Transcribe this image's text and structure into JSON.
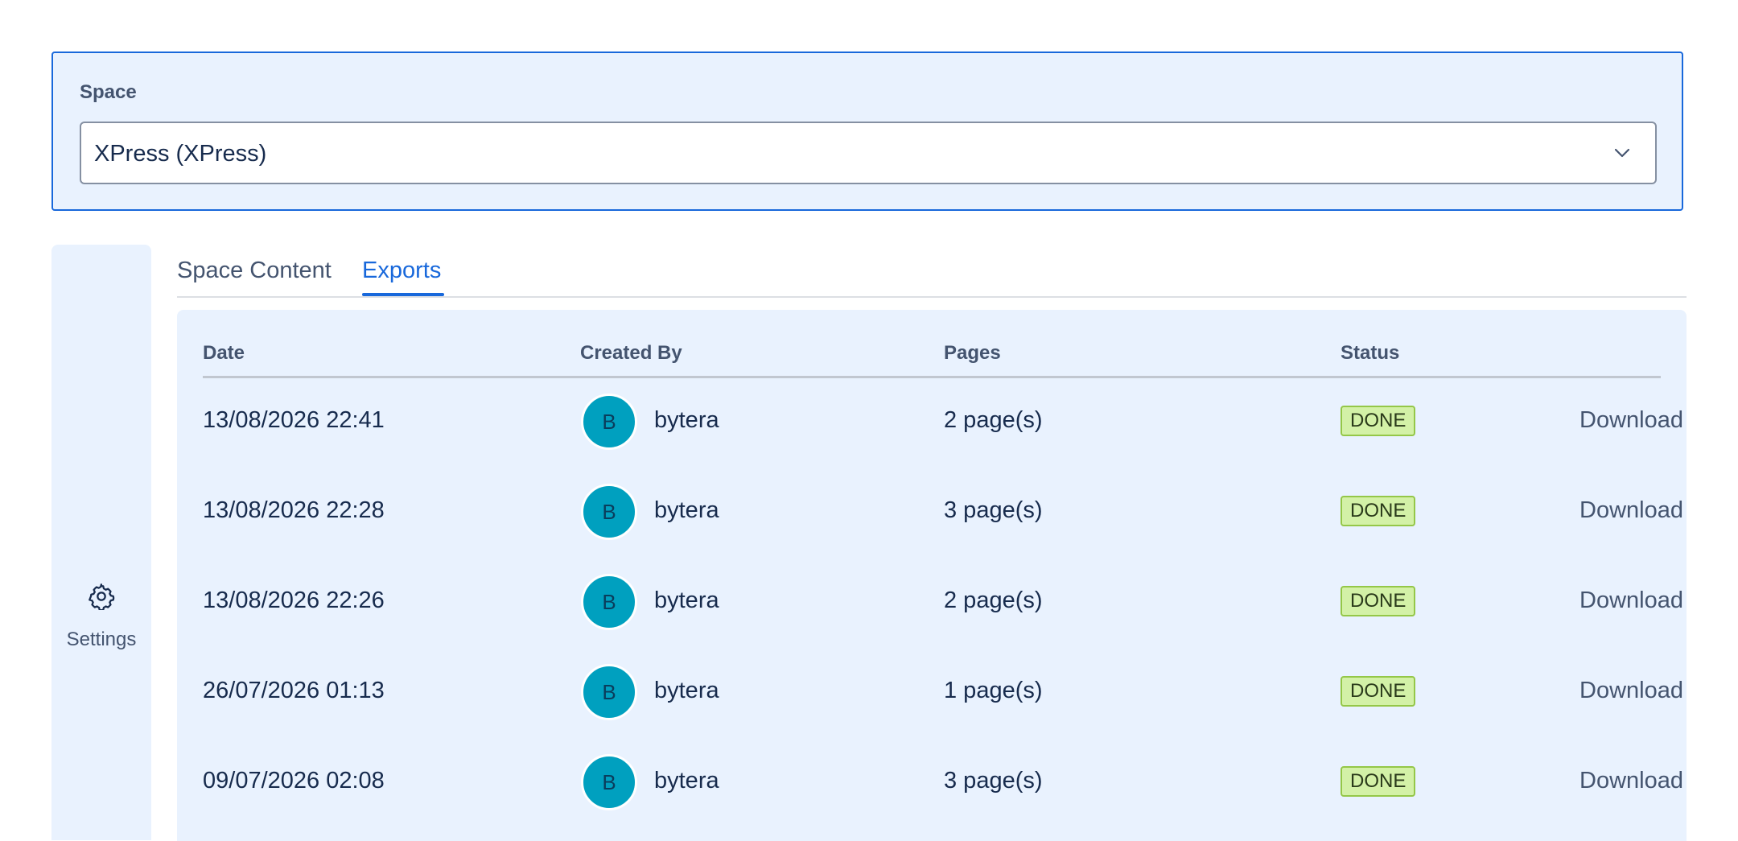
{
  "space_selector": {
    "label": "Space",
    "value": "XPress (XPress)"
  },
  "sidebar": {
    "settings_label": "Settings"
  },
  "tabs": [
    {
      "label": "Space Content",
      "active": false
    },
    {
      "label": "Exports",
      "active": true
    }
  ],
  "exports_table": {
    "columns": [
      "Date",
      "Created By",
      "Pages",
      "Status"
    ],
    "rows": [
      {
        "date": "13/08/2026 22:41",
        "avatar_initial": "B",
        "created_by": "bytera",
        "pages": "2 page(s)",
        "status": "DONE",
        "action": "Download"
      },
      {
        "date": "13/08/2026 22:28",
        "avatar_initial": "B",
        "created_by": "bytera",
        "pages": "3 page(s)",
        "status": "DONE",
        "action": "Download"
      },
      {
        "date": "13/08/2026 22:26",
        "avatar_initial": "B",
        "created_by": "bytera",
        "pages": "2 page(s)",
        "status": "DONE",
        "action": "Download"
      },
      {
        "date": "26/07/2026 01:13",
        "avatar_initial": "B",
        "created_by": "bytera",
        "pages": "1 page(s)",
        "status": "DONE",
        "action": "Download"
      },
      {
        "date": "09/07/2026 02:08",
        "avatar_initial": "B",
        "created_by": "bytera",
        "pages": "3 page(s)",
        "status": "DONE",
        "action": "Download"
      }
    ]
  },
  "icons": {
    "select_chevron": "chevron-down-icon",
    "settings": "gear-icon"
  },
  "colors": {
    "accent": "#1868db",
    "panel_background": "#e9f2fe",
    "avatar": "#00a0bf",
    "status_done_background": "#d3f1a7",
    "status_done_border": "#94c748"
  }
}
